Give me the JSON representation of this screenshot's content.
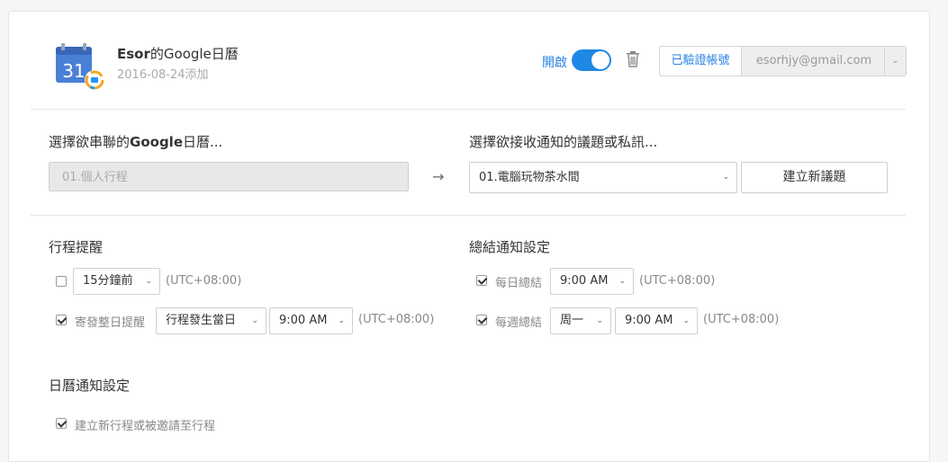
{
  "header": {
    "app_name_bold": "Esor",
    "app_name_rest": "的Google日曆",
    "added_date": "2016-08-24添加",
    "toggle_label": "開啟",
    "toggle_on": true,
    "verified_label": "已驗證帳號",
    "account_email": "esorhjy@gmail.com",
    "calendar_icon_number": "31"
  },
  "link_section": {
    "left_title_prefix": "選擇欲串聯的",
    "left_title_bold": "Google",
    "left_title_suffix": "日曆...",
    "left_selected": "01.個人行程",
    "right_title": "選擇欲接收通知的議題或私訊...",
    "right_selected": "01.電腦玩物茶水間",
    "new_topic_button": "建立新議題"
  },
  "reminder": {
    "title": "行程提醒",
    "row1": {
      "checked": false,
      "time": "15分鐘前",
      "tz": "(UTC+08:00)"
    },
    "row2": {
      "checked": true,
      "label": "寄發整日提醒",
      "when": "行程發生當日",
      "time": "9:00 AM",
      "tz": "(UTC+08:00)"
    }
  },
  "summary": {
    "title": "總結通知設定",
    "daily": {
      "checked": true,
      "label": "每日總結",
      "time": "9:00 AM",
      "tz": "(UTC+08:00)"
    },
    "weekly": {
      "checked": true,
      "label": "每週總結",
      "day": "周一",
      "time": "9:00 AM",
      "tz": "(UTC+08:00)"
    }
  },
  "calendar_notify": {
    "title": "日曆通知設定",
    "item1": {
      "checked": true,
      "label": "建立新行程或被邀請至行程"
    }
  },
  "colors": {
    "accent": "#1e88e5",
    "link": "#2a82e4"
  }
}
